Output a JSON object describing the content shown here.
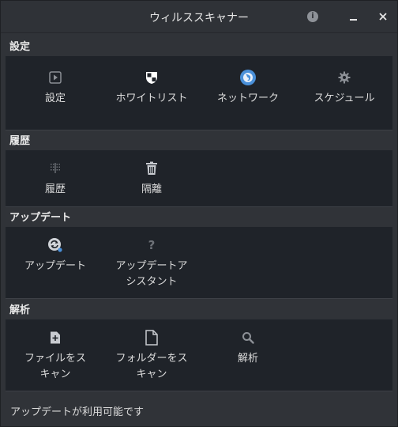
{
  "window": {
    "title": "ウィルススキャナー"
  },
  "sections": {
    "settings": {
      "title": "設定",
      "items": [
        {
          "label": "設定",
          "icon": "play-square-icon"
        },
        {
          "label": "ホワイトリスト",
          "icon": "shield-icon"
        },
        {
          "label": "ネットワーク",
          "icon": "globe-icon"
        },
        {
          "label": "スケジュール",
          "icon": "gear-icon"
        }
      ]
    },
    "history": {
      "title": "履歴",
      "items": [
        {
          "label": "履歴",
          "icon": "dotted-grid-icon"
        },
        {
          "label": "隔離",
          "icon": "trash-icon"
        }
      ]
    },
    "update": {
      "title": "アップデート",
      "items": [
        {
          "label": "アップデート",
          "icon": "update-icon"
        },
        {
          "label": "アップデートア",
          "label2": "シスタント",
          "icon": "question-icon"
        }
      ]
    },
    "analysis": {
      "title": "解析",
      "items": [
        {
          "label": "ファイルをス",
          "label2": "キャン",
          "icon": "file-plus-icon"
        },
        {
          "label": "フォルダーをス",
          "label2": "キャン",
          "icon": "document-icon"
        },
        {
          "label": "解析",
          "icon": "magnifier-icon"
        }
      ]
    }
  },
  "status_bar": {
    "text": "アップデートが利用可能です"
  },
  "colors": {
    "accent_blue": "#4a90d9",
    "panel_bg": "#1f2329",
    "window_bg": "#303338"
  }
}
